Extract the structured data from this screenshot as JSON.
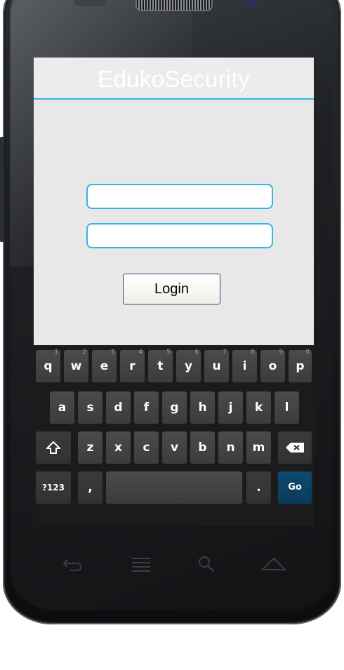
{
  "app": {
    "title": "EdukoSecurity"
  },
  "form": {
    "username_value": "",
    "password_value": "",
    "login_label": "Login"
  },
  "keyboard": {
    "row1": [
      {
        "label": "q",
        "hint": "1"
      },
      {
        "label": "w",
        "hint": "2"
      },
      {
        "label": "e",
        "hint": "3"
      },
      {
        "label": "r",
        "hint": "4"
      },
      {
        "label": "t",
        "hint": "5"
      },
      {
        "label": "y",
        "hint": "6"
      },
      {
        "label": "u",
        "hint": "7"
      },
      {
        "label": "i",
        "hint": "8"
      },
      {
        "label": "o",
        "hint": "9"
      },
      {
        "label": "p",
        "hint": "0"
      }
    ],
    "row2": [
      "a",
      "s",
      "d",
      "f",
      "g",
      "h",
      "j",
      "k",
      "l"
    ],
    "row3": [
      "z",
      "x",
      "c",
      "v",
      "b",
      "n",
      "m"
    ],
    "shift_icon": "shift-arrow-icon",
    "backspace_icon": "backspace-icon",
    "symbols_label": "?123",
    "comma_label": ",",
    "period_label": ".",
    "go_label": "Go",
    "go_color": "#0e4a72"
  },
  "nav": {
    "icons": [
      "back-icon",
      "menu-icon",
      "search-icon",
      "home-icon"
    ]
  },
  "colors": {
    "accent": "#33b5e5",
    "screen_bg": "#e8e8e8",
    "keyboard_bg": "#1b1b1b"
  }
}
